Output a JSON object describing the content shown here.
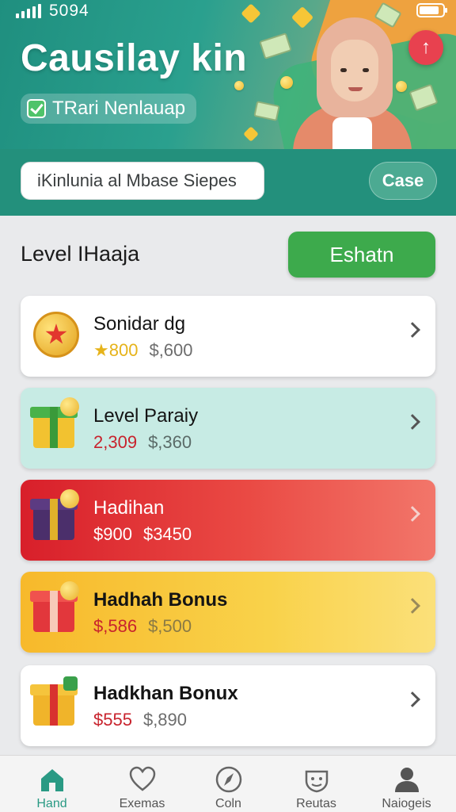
{
  "status_bar": {
    "time": "5094"
  },
  "header": {
    "title": "Causilay kin",
    "badge_label": "TRari Nenlauap",
    "share_icon": "share-arrow-icon",
    "accent": "#23907c"
  },
  "search": {
    "value": "iKinlunia al Mbase Siepes",
    "button_label": "Case"
  },
  "section": {
    "title": "Level IHaaja",
    "action_label": "Eshatn"
  },
  "cards": [
    {
      "title": "Sonidar dg",
      "value_a": "800",
      "value_b": "$,600",
      "icon": "medal-icon"
    },
    {
      "title": "Level Paraiy",
      "value_a": "2,309",
      "value_b": "$,360",
      "icon": "gift-box-icon"
    },
    {
      "title": "Hadihan",
      "value_a": "$900",
      "value_b": "$3450",
      "icon": "gift-box-icon"
    },
    {
      "title": "Hadhah Bonus",
      "value_a": "$,586",
      "value_b": "$,500",
      "icon": "gift-box-icon"
    },
    {
      "title": "Hadkhan Bonux",
      "value_a": "$555",
      "value_b": "$,890",
      "icon": "gift-box-icon"
    }
  ],
  "tabs": [
    {
      "label": "Hand",
      "icon": "home-icon"
    },
    {
      "label": "Exemas",
      "icon": "heart-icon"
    },
    {
      "label": "Coln",
      "icon": "compass-icon"
    },
    {
      "label": "Reutas",
      "icon": "badge-icon"
    },
    {
      "label": "Naiogeis",
      "icon": "profile-icon"
    }
  ]
}
